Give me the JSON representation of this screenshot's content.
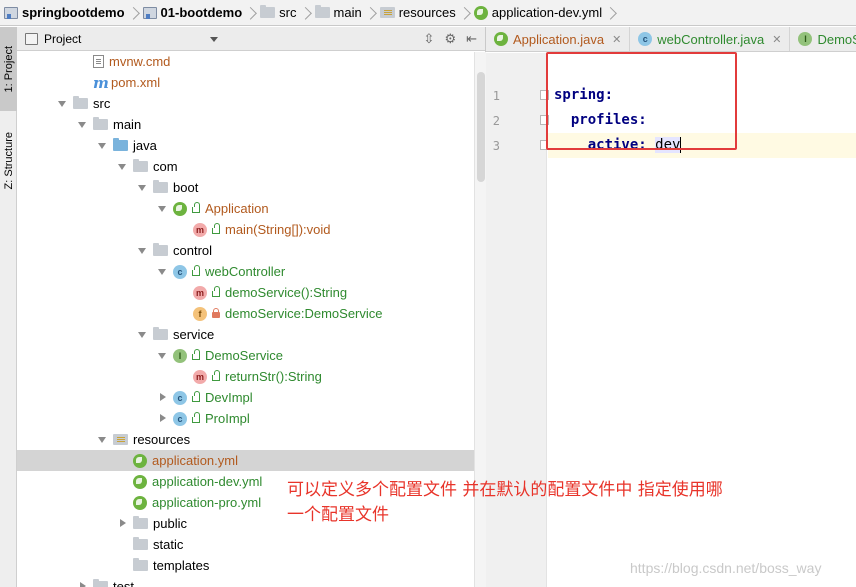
{
  "breadcrumb": [
    {
      "label": "springbootdemo",
      "icon": "module-icon",
      "bold": true
    },
    {
      "label": "01-bootdemo",
      "icon": "module-icon",
      "bold": true
    },
    {
      "label": "src",
      "icon": "folder-icon",
      "bold": false
    },
    {
      "label": "main",
      "icon": "folder-icon",
      "bold": false
    },
    {
      "label": "resources",
      "icon": "resources-folder-icon",
      "bold": false
    },
    {
      "label": "application-dev.yml",
      "icon": "spring-yml-icon",
      "bold": false
    }
  ],
  "stripe": {
    "project_tab": "1: Project",
    "structure_tab": "Z: Structure"
  },
  "project_panel": {
    "title": "Project",
    "tree": [
      {
        "label": "mvnw.cmd",
        "icon": "document-icon",
        "arrow": "none",
        "color": "red"
      },
      {
        "label": "pom.xml",
        "icon": "maven-icon",
        "arrow": "none",
        "color": "red"
      },
      {
        "label": "src",
        "icon": "folder-icon",
        "arrow": "open",
        "color": "plain"
      },
      {
        "label": "main",
        "icon": "folder-icon",
        "arrow": "open",
        "color": "plain"
      },
      {
        "label": "java",
        "icon": "source-folder-icon",
        "arrow": "open",
        "color": "plain"
      },
      {
        "label": "com",
        "icon": "package-icon",
        "arrow": "open",
        "color": "plain"
      },
      {
        "label": "boot",
        "icon": "package-icon",
        "arrow": "open",
        "color": "plain"
      },
      {
        "label": "Application",
        "icon": "spring-boot-class-icon",
        "arrow": "open",
        "color": "red",
        "lock": "open"
      },
      {
        "label": "main(String[]):void",
        "icon": "method-icon",
        "arrow": "none",
        "color": "red",
        "lock": "open"
      },
      {
        "label": "control",
        "icon": "package-icon",
        "arrow": "open",
        "color": "plain"
      },
      {
        "label": "webController",
        "icon": "class-icon",
        "arrow": "open",
        "color": "green",
        "lock": "open"
      },
      {
        "label": "demoService():String",
        "icon": "method-icon",
        "arrow": "none",
        "color": "green",
        "lock": "open"
      },
      {
        "label": "demoService:DemoService",
        "icon": "field-icon",
        "arrow": "none",
        "color": "green",
        "lock": "closed"
      },
      {
        "label": "service",
        "icon": "package-icon",
        "arrow": "open",
        "color": "plain"
      },
      {
        "label": "DemoService",
        "icon": "interface-icon",
        "arrow": "open",
        "color": "green",
        "lock": "open"
      },
      {
        "label": "returnStr():String",
        "icon": "method-icon",
        "arrow": "none",
        "color": "green",
        "lock": "open"
      },
      {
        "label": "DevImpl",
        "icon": "class-icon",
        "arrow": "closed",
        "color": "green",
        "lock": "open"
      },
      {
        "label": "ProImpl",
        "icon": "class-icon",
        "arrow": "closed",
        "color": "green",
        "lock": "open"
      },
      {
        "label": "resources",
        "icon": "resources-folder-icon",
        "arrow": "open",
        "color": "plain"
      },
      {
        "label": "application.yml",
        "icon": "spring-yml-icon",
        "arrow": "none",
        "color": "red",
        "selected": true
      },
      {
        "label": "application-dev.yml",
        "icon": "spring-yml-icon",
        "arrow": "none",
        "color": "green"
      },
      {
        "label": "application-pro.yml",
        "icon": "spring-yml-icon",
        "arrow": "none",
        "color": "green"
      },
      {
        "label": "public",
        "icon": "folder-icon",
        "arrow": "closed",
        "color": "plain"
      },
      {
        "label": "static",
        "icon": "folder-icon",
        "arrow": "none",
        "color": "plain"
      },
      {
        "label": "templates",
        "icon": "folder-icon",
        "arrow": "none",
        "color": "plain"
      },
      {
        "label": "test",
        "icon": "folder-icon",
        "arrow": "closed",
        "color": "plain"
      }
    ]
  },
  "editor": {
    "tabs": [
      {
        "label": "Application.java",
        "icon": "spring-boot-class-icon",
        "color": "red"
      },
      {
        "label": "webController.java",
        "icon": "class-icon",
        "color": "green"
      },
      {
        "label": "DemoSe",
        "icon": "interface-icon",
        "color": "green"
      }
    ],
    "line_numbers": [
      "1",
      "2",
      "3"
    ],
    "code": {
      "line1_key": "spring:",
      "line2_key": "profiles:",
      "line3_key": "active:",
      "line3_value": "dev"
    }
  },
  "annotation": {
    "line1": "可以定义多个配置文件    并在默认的配置文件中 指定使用哪",
    "line2": "一个配置文件"
  },
  "watermark": "https://blog.csdn.net/boss_way",
  "colors": {
    "accent_red": "#e23b3b",
    "vcs_green": "#2f8a2f",
    "vcs_modified": "#b25a1e",
    "yaml_key": "#000080"
  }
}
